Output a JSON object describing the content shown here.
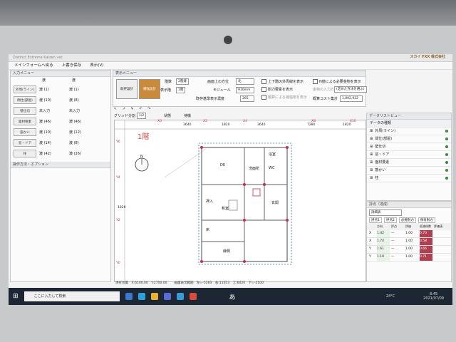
{
  "window": {
    "title": "Distinct Extreme Kaizen ver."
  },
  "menu": {
    "items": [
      "メインフォームへ戻る",
      "上書き保存",
      "表示(V)"
    ]
  },
  "brand": {
    "logos": [
      "スカイ",
      "FXX 株式会社"
    ]
  },
  "input_menu": {
    "header": "入力メニュー",
    "col_a": "渡",
    "col_b": "渡",
    "rows": [
      {
        "label": "外周(ライン)",
        "a": "渡 (1)",
        "b": "渡 (1)"
      },
      {
        "label": "間仕(部屋)",
        "a": "渡 (10)",
        "b": "渡 (8)"
      },
      {
        "label": "壁仕切",
        "a": "未入力",
        "b": "未入力"
      },
      {
        "label": "面材要素",
        "a": "渡 (46)",
        "b": "渡 (46)"
      },
      {
        "label": "筋かい",
        "a": "渡 (10)",
        "b": "渡 (12)"
      },
      {
        "label": "窓・ドア",
        "a": "渡 (14)",
        "b": "渡 (8)"
      },
      {
        "label": "柱",
        "a": "渡 (42)",
        "b": "渡 (26)"
      }
    ],
    "options_header": "操作方法・オプション"
  },
  "display_menu": {
    "header": "表示メニュー",
    "btn_existing": "既存設計",
    "btn_reinforce": "補強設計",
    "floor_label": "階数",
    "floor_value": "2階建",
    "display_floor_label": "表示階",
    "display_floor_value": "1階",
    "direction_label": "画面上の方位",
    "direction_value": "北",
    "module_label": "モジュール",
    "module_value": "910mm",
    "cost_label": "既存基準表示濃度",
    "cost_value": "265",
    "chk_upper": "上下階の外周線を表示",
    "chk_axial": "耐力要素を表示",
    "chk_hidden": "軸算による補強物を表示",
    "chk_needed": "N値による必要金物を表示",
    "chk_reason": "金物の入力方法",
    "reason_value": "(定めた方法を選ぶ)",
    "total_label": "概算コスト集計",
    "total_value": "1,892,932",
    "grid_label": "グリッド分割",
    "grid_value": "1/2",
    "state_label": "状態",
    "state_value": "待機"
  },
  "plan": {
    "floor_label": "1階",
    "north": "N",
    "rooms": [
      "DK",
      "和室",
      "洗面所",
      "WC",
      "浴室",
      "玄関",
      "縁側",
      "押入",
      "床"
    ],
    "dims": [
      "3640",
      "1820",
      "3640",
      "7280",
      "1820",
      "1820"
    ],
    "grid_labels": [
      "X0",
      "X2",
      "X4",
      "X8",
      "X10",
      "Y6",
      "Y4",
      "Y2",
      "Y0"
    ]
  },
  "status": {
    "coords": "現在位置　X:6100.00　Y:2700.00",
    "view": "画面表示範囲　左=-5283　右:11653　上:6020　下=-2100"
  },
  "data_list": {
    "header": "データリストビュー",
    "subheader": "データの種類",
    "items": [
      "外周(ライン)",
      "間仕(部屋)",
      "壁仕切",
      "窓・ドア",
      "面材要素",
      "筋かい",
      "柱"
    ]
  },
  "eval": {
    "header": "評点（達成）",
    "select": "詳細表",
    "tabs": [
      "評点1",
      "評点2",
      "必要耐力",
      "保有耐力"
    ],
    "col_headers": [
      "方向",
      "評点",
      "評価",
      "低減係数",
      "評価値"
    ],
    "rows": [
      {
        "dir": "X",
        "v": "1.42",
        "mid": "—",
        "c": "1.00",
        "r": "0.70"
      },
      {
        "dir": "X",
        "v": "1.74",
        "mid": "—",
        "c": "1.00",
        "r": "0.58"
      },
      {
        "dir": "Y",
        "v": "1.61",
        "mid": "—",
        "c": "1.00",
        "r": "0.66"
      },
      {
        "dir": "Y",
        "v": "1.10",
        "mid": "—",
        "c": "1.00",
        "r": "0.71"
      }
    ]
  },
  "taskbar": {
    "search": "ここに入力して検索",
    "temp": "24°C",
    "time": "8:45",
    "date": "2021/07/09",
    "ime": "あ"
  },
  "colors": {
    "accent": "#c98a3a",
    "brand": "#8a6a2e",
    "taskbar": "#1d2733"
  }
}
